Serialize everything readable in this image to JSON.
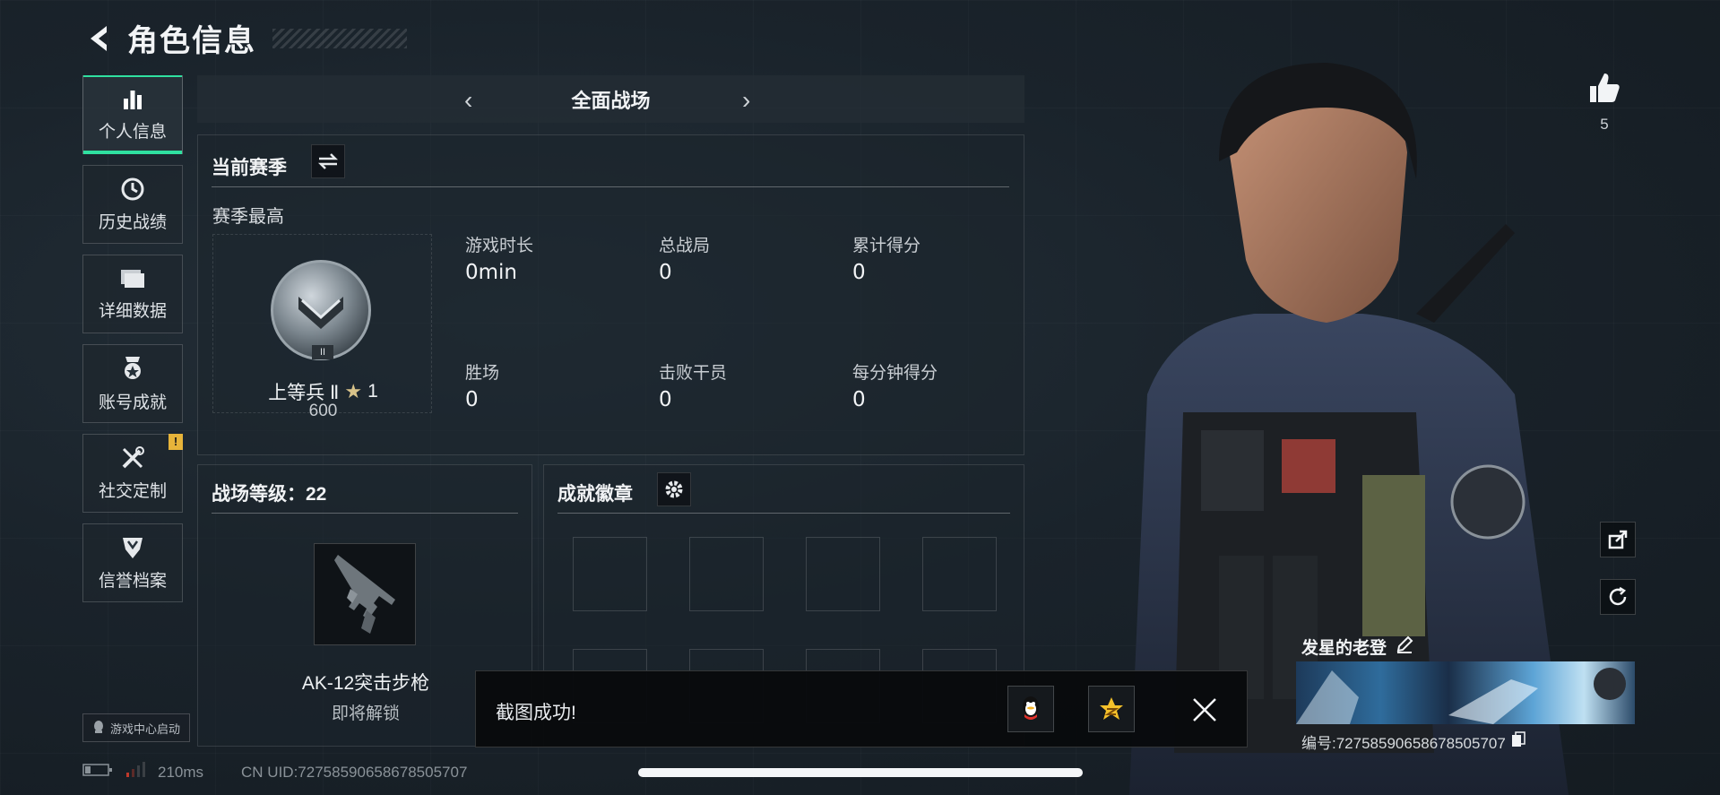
{
  "header": {
    "title": "角色信息"
  },
  "sidebar": {
    "items": [
      {
        "label": "个人信息",
        "icon": "bar-chart-icon",
        "active": true
      },
      {
        "label": "历史战绩",
        "icon": "clock-icon"
      },
      {
        "label": "详细数据",
        "icon": "folder-icon"
      },
      {
        "label": "账号成就",
        "icon": "medal-icon"
      },
      {
        "label": "社交定制",
        "icon": "tools-icon",
        "badge": "!"
      },
      {
        "label": "信誉档案",
        "icon": "shield-icon"
      }
    ],
    "game_center": "游戏中心启动"
  },
  "mode": {
    "title": "全面战场"
  },
  "season": {
    "title": "当前赛季",
    "best_label": "赛季最高",
    "rank_name": "上等兵 Ⅱ",
    "rank_stars": "1",
    "rank_points": "600",
    "rank_roman": "II",
    "stats": [
      {
        "label": "游戏时长",
        "value": "0min"
      },
      {
        "label": "总战局",
        "value": "0"
      },
      {
        "label": "累计得分",
        "value": "0"
      },
      {
        "label": "胜场",
        "value": "0"
      },
      {
        "label": "击败干员",
        "value": "0"
      },
      {
        "label": "每分钟得分",
        "value": "0"
      }
    ]
  },
  "level": {
    "title": "战场等级：22",
    "weapon_name": "AK-12突击步枪",
    "weapon_status": "即将解锁"
  },
  "achievements": {
    "title": "成就徽章"
  },
  "toast": {
    "text": "截图成功!"
  },
  "status": {
    "ping": "210ms",
    "uid": "CN UID:72758590658678505707"
  },
  "profile": {
    "likes": "5",
    "name": "发星的老登",
    "id": "编号:72758590658678505707"
  },
  "colors": {
    "accent": "#2fe0a0",
    "warn": "#e7b43a"
  }
}
